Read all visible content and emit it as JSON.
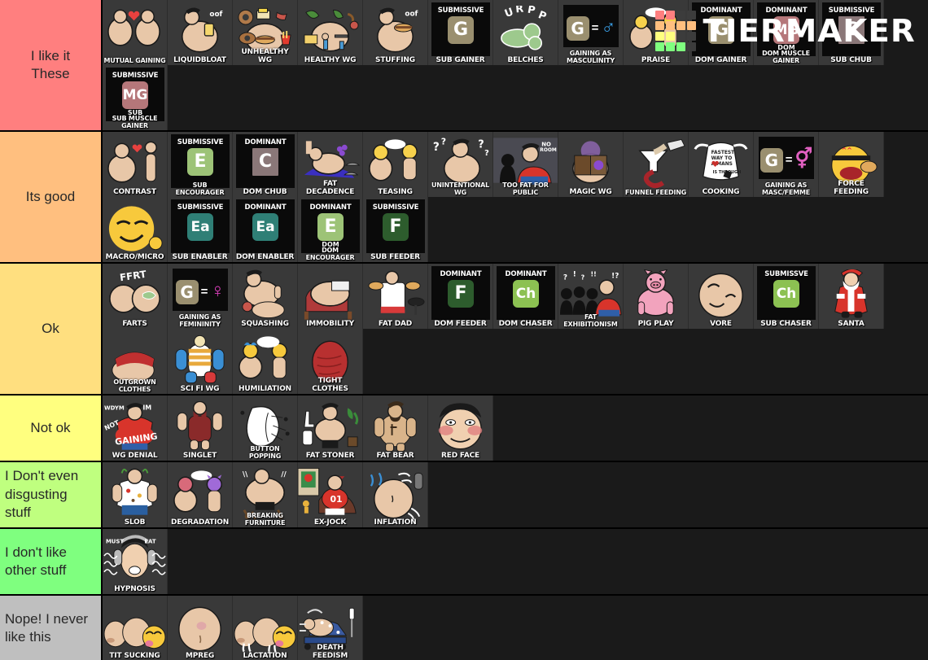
{
  "app": {
    "brand_name": "TIERMAKER"
  },
  "brand_colors": {
    "red": "#ff7f7f",
    "orange": "#ffbf7f",
    "yellow": "#ffff7f",
    "green": "#7fff7f",
    "dark": "#3c3c3c"
  },
  "badge_colors": {
    "G": "#9a8f6f",
    "MG": "#b5777a",
    "C": "#8a7778",
    "E_light": "#9dc377",
    "Ea": "#2f7f76",
    "F": "#2d5c2d",
    "Ch": "#8cc152",
    "F_dark": "#2d5c2d"
  },
  "tiers": [
    {
      "label": "I like it\nThese",
      "color": "#ff7f7f",
      "label_align": "center",
      "items": [
        {
          "name": "MUTUAL GAINING",
          "art": "two-blobs-heart"
        },
        {
          "name": "LIQUIDBLOAT",
          "art": "man-drink-oof"
        },
        {
          "name": "UNHEALTHY WG",
          "art": "junk-food-belly"
        },
        {
          "name": "HEALTHY WG",
          "art": "veggie-belly"
        },
        {
          "name": "STUFFING",
          "art": "man-burger-oof"
        },
        {
          "name": "SUB GAINER",
          "art": "badge",
          "role": "SUBMISSIVE",
          "letter": "G",
          "tile_color": "#9a8f6f"
        },
        {
          "name": "BELCHES",
          "art": "urpp-cloud"
        },
        {
          "name": "GAINING AS MASCULINITY",
          "art": "badge-eq",
          "letter": "G",
          "tile_color": "#9a8f6f",
          "symbol": "♂",
          "symbol_color": "#3aa0e8"
        },
        {
          "name": "PRAISE",
          "art": "two-figs-speech"
        },
        {
          "name": "DOM GAINER",
          "art": "badge",
          "role": "DOMINANT",
          "letter": "G",
          "tile_color": "#9a8f6f"
        },
        {
          "name": "DOM MUSCLE GAINER",
          "art": "badge",
          "role": "DOMINANT",
          "sub": "DOM",
          "letter": "MG",
          "tile_color": "#b5777a"
        },
        {
          "name": "SUB  CHUB",
          "art": "badge",
          "role": "SUBMISSIVE",
          "letter": "C",
          "tile_color": "#8a7778",
          "square": true
        },
        {
          "name": "SUB MUSCLE GAINER",
          "art": "badge",
          "role": "SUBMISSIVE",
          "sub": "SUB",
          "letter": "MG",
          "tile_color": "#b5777a"
        }
      ]
    },
    {
      "label": "Its good",
      "color": "#ffbf7f",
      "label_align": "center",
      "items": [
        {
          "name": "CONTRAST",
          "art": "fat-thin-heart"
        },
        {
          "name": "SUB ENCOURAGER",
          "art": "badge",
          "role": "SUBMISSIVE",
          "letter": "E",
          "tile_color": "#9dc377"
        },
        {
          "name": "DOM CHUB",
          "art": "badge",
          "role": "DOMINANT",
          "letter": "C",
          "tile_color": "#8a7778",
          "square": true
        },
        {
          "name": "FAT DECADENCE",
          "art": "lounging-grapes"
        },
        {
          "name": "TEASING",
          "art": "two-emoji-figs"
        },
        {
          "name": "UNINTENTIONAL WG",
          "art": "confused-man"
        },
        {
          "name": "TOO FAT FOR PUBLIC",
          "art": "crowd-red-shirt"
        },
        {
          "name": "MAGIC WG",
          "art": "magic-book"
        },
        {
          "name": "FUNNEL FEEDING",
          "art": "funnel"
        },
        {
          "name": "COOKING",
          "art": "apron-note"
        },
        {
          "name": "GAINING AS MASC/FEMME",
          "art": "badge-eq",
          "letter": "G",
          "tile_color": "#9a8f6f",
          "symbol": "⚥",
          "symbol_color": "#e060c0"
        },
        {
          "name": "FORCE FEEDING",
          "art": "force-feed-emoji"
        },
        {
          "name": "MACRO/MICRO",
          "art": "smirk-emoji"
        },
        {
          "name": "SUB ENABLER",
          "art": "badge",
          "role": "SUBMISSIVE",
          "letter": "Ea",
          "tile_color": "#2f7f76"
        },
        {
          "name": "DOM ENABLER",
          "art": "badge",
          "role": "DOMINANT",
          "letter": "Ea",
          "tile_color": "#2f7f76"
        },
        {
          "name": "DOM ENCOURAGER",
          "art": "badge",
          "role": "DOMINANT",
          "sub": "DOM",
          "letter": "E",
          "tile_color": "#9dc377"
        },
        {
          "name": "SUB  FEEDER",
          "art": "badge",
          "role": "SUBMISSIVE",
          "letter": "F",
          "tile_color": "#2d5c2d"
        }
      ]
    },
    {
      "label": "Ok",
      "color": "#ffdf7f",
      "label_align": "center",
      "items": [
        {
          "name": "FARTS",
          "art": "ffrt-butt"
        },
        {
          "name": "GAINING AS FEMININITY",
          "art": "badge-eq",
          "letter": "G",
          "tile_color": "#9a8f6f",
          "symbol": "♀",
          "symbol_color": "#e040c0"
        },
        {
          "name": "SQUASHING",
          "art": "squashing"
        },
        {
          "name": "IMMOBILITY",
          "art": "couch-belly"
        },
        {
          "name": "FAT DAD",
          "art": "grill-dad"
        },
        {
          "name": "DOM FEEDER",
          "art": "badge",
          "role": "DOMINANT",
          "letter": "F",
          "tile_color": "#2d5c2d"
        },
        {
          "name": "DOM CHASER",
          "art": "badge",
          "role": "DOMINANT",
          "letter": "Ch",
          "tile_color": "#8cc152"
        },
        {
          "name": "FAT EXHIBITIONISM",
          "art": "crowd-stare"
        },
        {
          "name": "PIG PLAY",
          "art": "pig"
        },
        {
          "name": "VORE",
          "art": "big-face"
        },
        {
          "name": "SUB  CHASER",
          "art": "badge",
          "role": "SUBMISSVE",
          "letter": "Ch",
          "tile_color": "#8cc152"
        },
        {
          "name": "SANTA",
          "art": "santa"
        },
        {
          "name": "OUTGROWN CLOTHES",
          "art": "red-shirt-belly"
        },
        {
          "name": "SCI FI WG",
          "art": "scifi-suit"
        },
        {
          "name": "HUMILIATION",
          "art": "two-emoji-speech"
        },
        {
          "name": "TIGHT CLOTHES",
          "art": "tight-red"
        }
      ]
    },
    {
      "label": "Not ok",
      "color": "#ffff7f",
      "label_align": "center",
      "items": [
        {
          "name": "WG DENIAL",
          "art": "wdym-gaining"
        },
        {
          "name": "SINGLET",
          "art": "singlet"
        },
        {
          "name": "BUTTON POPPING",
          "art": "button-pop"
        },
        {
          "name": "FAT STONER",
          "art": "stoner"
        },
        {
          "name": "FAT BEAR",
          "art": "bear"
        },
        {
          "name": "RED FACE",
          "art": "red-face"
        }
      ]
    },
    {
      "label": "I Don't even disgusting stuff",
      "color": "#bfff7f",
      "label_align": "left",
      "items": [
        {
          "name": "SLOB",
          "art": "slob"
        },
        {
          "name": "DEGRADATION",
          "art": "devil-figs"
        },
        {
          "name": "BREAKING FURNITURE",
          "art": "breaking"
        },
        {
          "name": "EX-JOCK",
          "art": "ex-jock"
        },
        {
          "name": "INFLATION",
          "art": "inflation"
        }
      ]
    },
    {
      "label": "I don't like other stuff",
      "color": "#7fff7f",
      "label_align": "left",
      "items": [
        {
          "name": "HYPNOSIS",
          "art": "hypnosis"
        }
      ]
    },
    {
      "label": "Nope! I never like this",
      "color": "#bfbfbf",
      "label_align": "left",
      "items": [
        {
          "name": "TIT SUCKING",
          "art": "tit-sucking"
        },
        {
          "name": "MPREG",
          "art": "mpreg"
        },
        {
          "name": "LACTATION",
          "art": "lactation"
        },
        {
          "name": "DEATH FEEDISM",
          "art": "hospital-bed"
        }
      ]
    }
  ]
}
